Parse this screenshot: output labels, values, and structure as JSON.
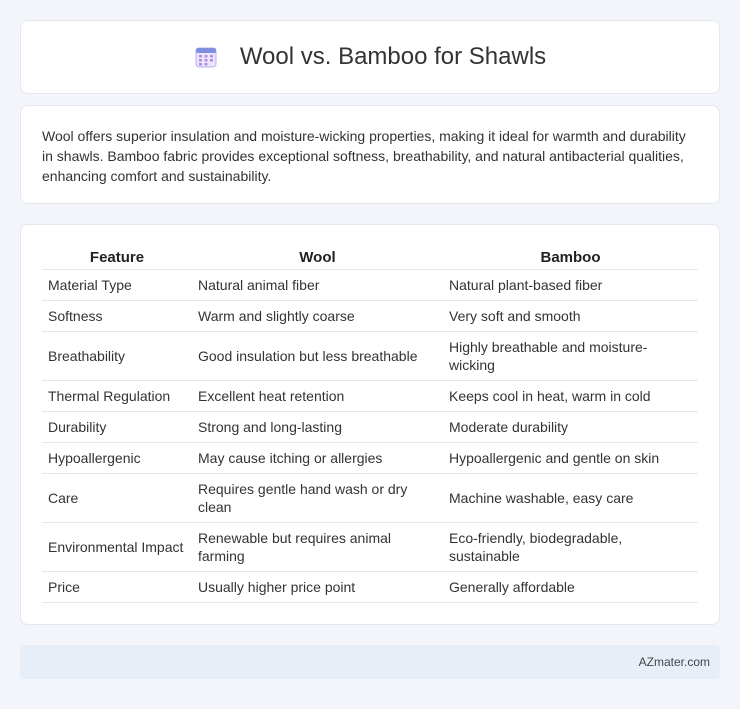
{
  "header": {
    "title": "Wool vs. Bamboo for Shawls",
    "icon": "calendar-icon"
  },
  "summary": {
    "text": "Wool offers superior insulation and moisture-wicking properties, making it ideal for warmth and durability in shawls. Bamboo fabric provides exceptional softness, breathability, and natural antibacterial qualities, enhancing comfort and sustainability."
  },
  "table": {
    "headers": [
      "Feature",
      "Wool",
      "Bamboo"
    ],
    "rows": [
      [
        "Material Type",
        "Natural animal fiber",
        "Natural plant-based fiber"
      ],
      [
        "Softness",
        "Warm and slightly coarse",
        "Very soft and smooth"
      ],
      [
        "Breathability",
        "Good insulation but less breathable",
        "Highly breathable and moisture-wicking"
      ],
      [
        "Thermal Regulation",
        "Excellent heat retention",
        "Keeps cool in heat, warm in cold"
      ],
      [
        "Durability",
        "Strong and long-lasting",
        "Moderate durability"
      ],
      [
        "Hypoallergenic",
        "May cause itching or allergies",
        "Hypoallergenic and gentle on skin"
      ],
      [
        "Care",
        "Requires gentle hand wash or dry clean",
        "Machine washable, easy care"
      ],
      [
        "Environmental Impact",
        "Renewable but requires animal farming",
        "Eco-friendly, biodegradable, sustainable"
      ],
      [
        "Price",
        "Usually higher price point",
        "Generally affordable"
      ]
    ]
  },
  "footer": {
    "brand": "AZmater.com"
  },
  "colors": {
    "background": "#f3f5fa",
    "card": "#ffffff",
    "border": "#e3e7ef",
    "footer_bg": "#e8eef8",
    "icon_accent": "#6b7bd6"
  }
}
